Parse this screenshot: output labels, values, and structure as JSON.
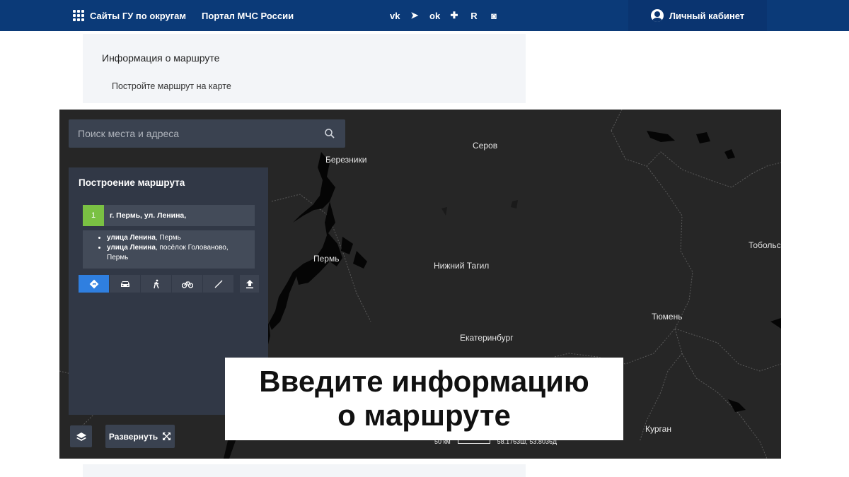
{
  "topbar": {
    "links": [
      "Сайты ГУ по округам",
      "Портал МЧС России"
    ],
    "social": [
      {
        "icon": "vk-icon",
        "glyph": "vk"
      },
      {
        "icon": "telegram-icon",
        "glyph": "➤"
      },
      {
        "icon": "odnoklassniki-icon",
        "glyph": "ok"
      },
      {
        "icon": "plus-circle-icon",
        "glyph": "✚"
      },
      {
        "icon": "rutube-icon",
        "glyph": "R"
      },
      {
        "icon": "camera-icon",
        "glyph": "◙"
      }
    ],
    "cabinet_label": "Личный кабинет"
  },
  "route_info": {
    "title": "Информация о маршруте",
    "subtitle": "Постройте маршрут на карте"
  },
  "map": {
    "search_placeholder": "Поиск места и адреса",
    "panel_title": "Построение маршрута",
    "point": {
      "number": "1",
      "value": "г. Пермь, ул. Ленина,"
    },
    "suggestions": [
      {
        "bold": "улица Ленина",
        "rest": ", Пермь"
      },
      {
        "bold": "улица Ленина",
        "rest": ", посёлок Голованово, Пермь"
      }
    ],
    "modes": [
      "directions-icon",
      "car-icon",
      "walk-icon",
      "bike-icon",
      "line-icon"
    ],
    "expand_label": "Развернуть",
    "cities": [
      "Березники",
      "Серов",
      "Пермь",
      "Нижний Тагил",
      "Тобольск",
      "Тюмень",
      "Екатеринбург",
      "Курган"
    ],
    "scale_label": "50 км",
    "coords": "58.1763Ш, 53.8036Д"
  },
  "overlay_text": {
    "line1": "Введите информацию",
    "line2": "о маршруте"
  },
  "colors": {
    "topbar": "#0b3a78",
    "map_bg": "#262626",
    "panel": "#313846",
    "active_mode": "#2f7fe0",
    "point_badge": "#7ac143"
  }
}
